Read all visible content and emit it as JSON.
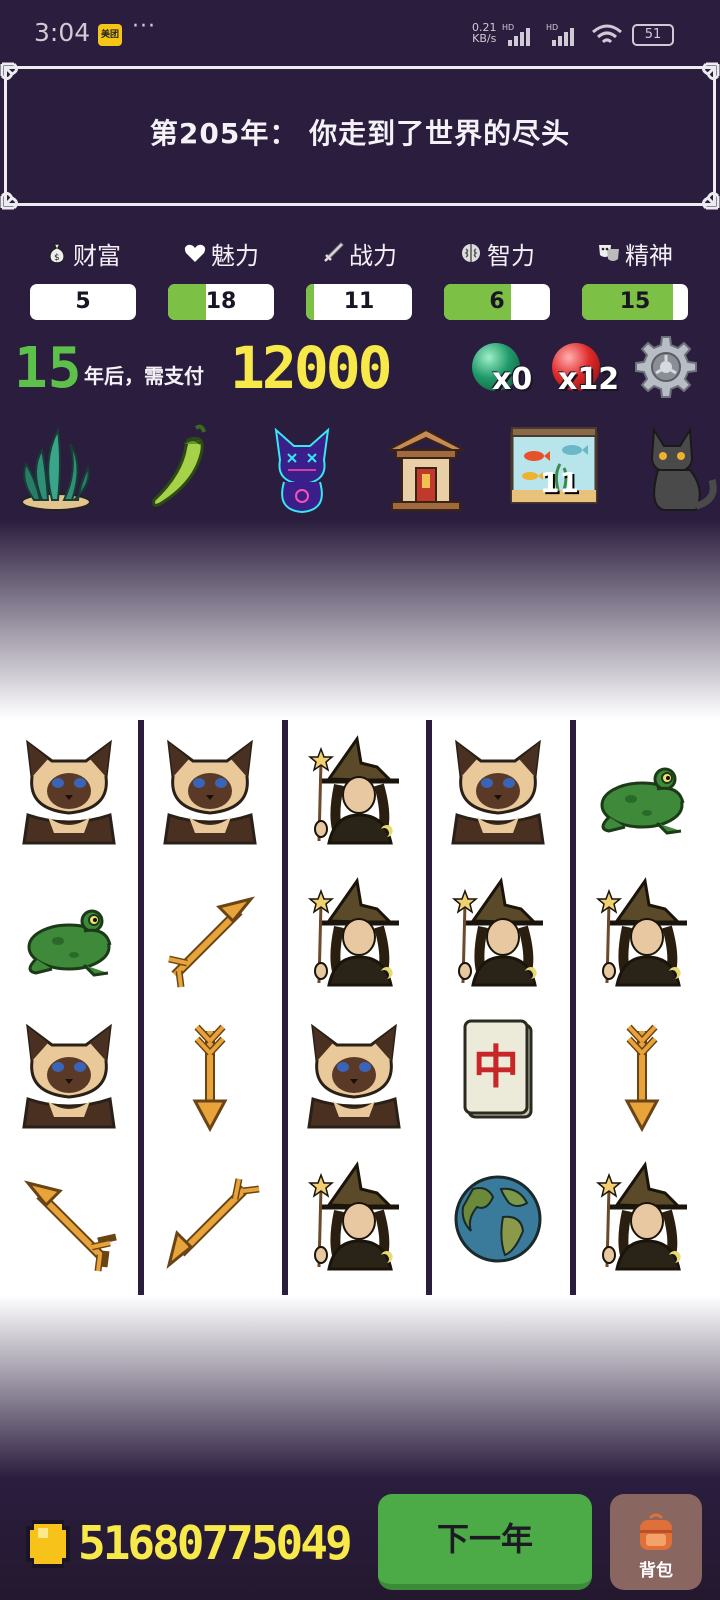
{
  "status_bar": {
    "time": "3:04",
    "app_badge": "美团",
    "dots": "···",
    "net_speed": "0.21",
    "net_unit": "KB/s",
    "battery": "51"
  },
  "banner": {
    "title": "第205年： 你走到了世界的尽头"
  },
  "stats": [
    {
      "label": "财富",
      "value": "5",
      "fill": 0,
      "icon": "money-bag-icon"
    },
    {
      "label": "魅力",
      "value": "18",
      "fill": 0.36,
      "icon": "heart-icon"
    },
    {
      "label": "战力",
      "value": "11",
      "fill": 0.08,
      "icon": "sword-icon"
    },
    {
      "label": "智力",
      "value": "6",
      "fill": 0.63,
      "icon": "brain-icon"
    },
    {
      "label": "精神",
      "value": "15",
      "fill": 0.86,
      "icon": "masks-icon"
    }
  ],
  "payment": {
    "years": "15",
    "text": "年后，需支付",
    "amount": "12000"
  },
  "orbs": [
    {
      "name": "green-orb",
      "count": "x0",
      "color": "#1f9a6a"
    },
    {
      "name": "red-orb",
      "count": "x12",
      "color": "#e02a2a"
    }
  ],
  "items": [
    {
      "name": "seaweed-icon"
    },
    {
      "name": "chili-pepper-icon"
    },
    {
      "name": "cyber-cat-icon"
    },
    {
      "name": "shrine-icon"
    },
    {
      "name": "fish-tank-icon",
      "badge": "11"
    },
    {
      "name": "black-cat-icon"
    }
  ],
  "reels": [
    [
      "siamese-cat",
      "frog",
      "siamese-cat",
      "arrow-up-left"
    ],
    [
      "siamese-cat",
      "arrow-up-right",
      "arrow-down",
      "arrow-down-left"
    ],
    [
      "witch",
      "witch",
      "siamese-cat",
      "witch"
    ],
    [
      "siamese-cat",
      "witch",
      "mahjong-zhong",
      "earth"
    ],
    [
      "frog",
      "witch",
      "arrow-down",
      "witch"
    ]
  ],
  "mahjong_char": "中",
  "bottom": {
    "coins": "51680775049",
    "next_label": "下一年",
    "bag_label": "背包"
  },
  "colors": {
    "background": "#2b1d3e",
    "stat_fill": "#7cc045",
    "years_green": "#5cc04a",
    "amount_yellow": "#f7e94a",
    "next_button": "#4caa47",
    "bag_button": "#8a6661"
  }
}
